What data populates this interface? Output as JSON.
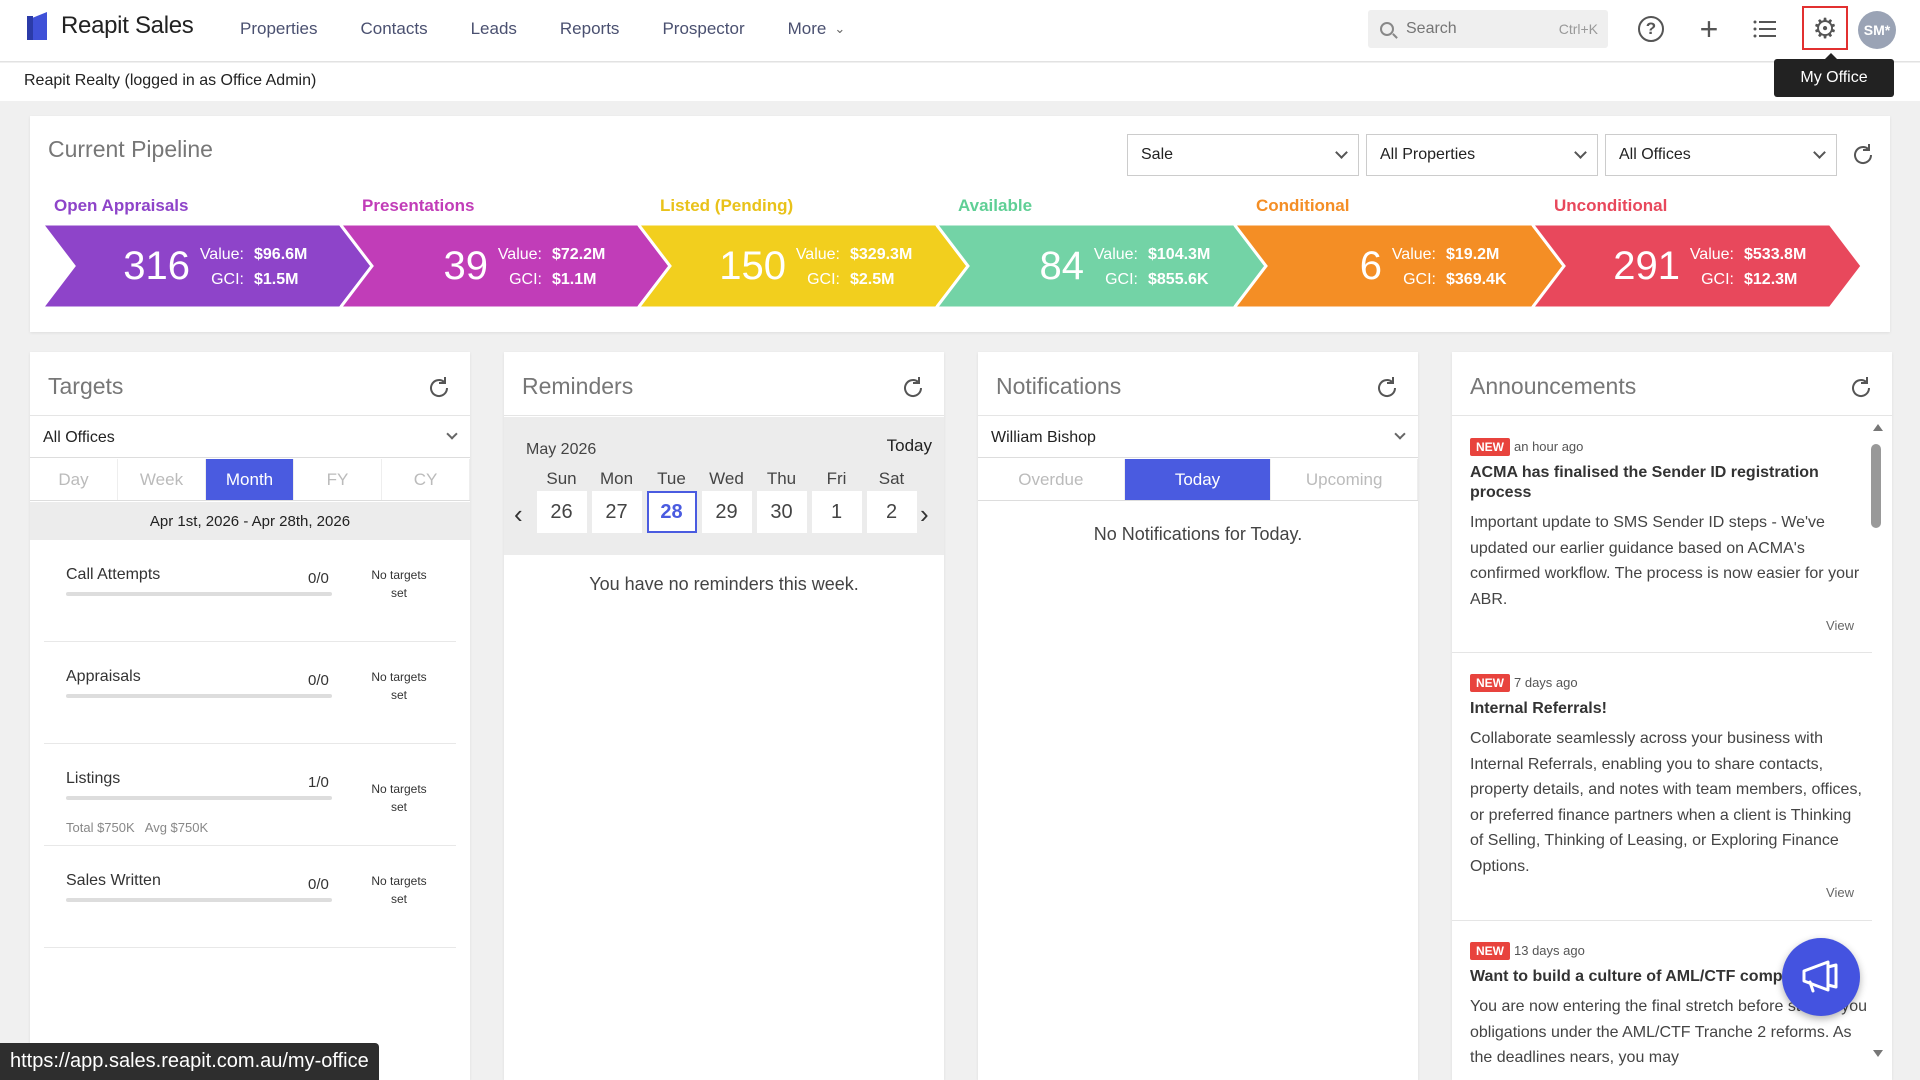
{
  "app": {
    "logo_text": "Reapit Sales",
    "context": "Reapit Realty (logged in as Office Admin)"
  },
  "nav": {
    "items": [
      "Properties",
      "Contacts",
      "Leads",
      "Reports",
      "Prospector",
      "More"
    ]
  },
  "search": {
    "placeholder": "Search",
    "shortcut": "Ctrl+K"
  },
  "toolbar": {
    "avatar_initials": "SM*",
    "tooltip": "My Office",
    "icons": [
      "help-icon",
      "plus-icon",
      "list-icon",
      "gear-icon"
    ]
  },
  "pipeline": {
    "title": "Current Pipeline",
    "filters": {
      "type": "Sale",
      "properties": "All Properties",
      "offices": "All Offices"
    },
    "value_label": "Value:",
    "gci_label": "GCI:",
    "stages": [
      {
        "label": "Open Appraisals",
        "count": "316",
        "value": "$96.6M",
        "gci": "$1.5M",
        "color": "#8e44c9"
      },
      {
        "label": "Presentations",
        "count": "39",
        "value": "$72.2M",
        "gci": "$1.1M",
        "color": "#c13db8"
      },
      {
        "label": "Listed (Pending)",
        "count": "150",
        "value": "$329.3M",
        "gci": "$2.5M",
        "color": "#f2cf1e"
      },
      {
        "label": "Available",
        "count": "84",
        "value": "$104.3M",
        "gci": "$855.6K",
        "color": "#73d3a6"
      },
      {
        "label": "Conditional",
        "count": "6",
        "value": "$19.2M",
        "gci": "$369.4K",
        "color": "#f48e25"
      },
      {
        "label": "Unconditional",
        "count": "291",
        "value": "$533.8M",
        "gci": "$12.3M",
        "color": "#e8485c"
      }
    ]
  },
  "targets": {
    "title": "Targets",
    "office_select": "All Offices",
    "tabs": [
      "Day",
      "Week",
      "Month",
      "FY",
      "CY"
    ],
    "active_tab": "Month",
    "date_range": "Apr 1st, 2026 - Apr 28th, 2026",
    "rows": [
      {
        "name": "Call Attempts",
        "ratio": "0/0",
        "note_line1": "No targets",
        "note_line2": "set",
        "sub": ""
      },
      {
        "name": "Appraisals",
        "ratio": "0/0",
        "note_line1": "No targets",
        "note_line2": "set",
        "sub": ""
      },
      {
        "name": "Listings",
        "ratio": "1/0",
        "note_line1": "No targets",
        "note_line2": "set",
        "sub": "Total $750K   Avg $750K"
      },
      {
        "name": "Sales Written",
        "ratio": "0/0",
        "note_line1": "No targets",
        "note_line2": "set",
        "sub": ""
      }
    ]
  },
  "reminders": {
    "title": "Reminders",
    "month": "May 2026",
    "today_label": "Today",
    "days": [
      "Sun",
      "Mon",
      "Tue",
      "Wed",
      "Thu",
      "Fri",
      "Sat"
    ],
    "dates": [
      "26",
      "27",
      "28",
      "29",
      "30",
      "1",
      "2"
    ],
    "selected_date": "28",
    "empty": "You have no reminders this week."
  },
  "notifications": {
    "title": "Notifications",
    "user_select": "William Bishop",
    "tabs": [
      "Overdue",
      "Today",
      "Upcoming"
    ],
    "active_tab": "Today",
    "empty": "No Notifications for Today."
  },
  "announcements": {
    "title": "Announcements",
    "badge": "NEW",
    "view_label": "View",
    "items": [
      {
        "ago": "an hour ago",
        "title": "ACMA has finalised the Sender ID registration process",
        "body": "Important update to SMS Sender ID steps - We've updated our earlier guidance based on ACMA's confirmed workflow. The process is now easier for your ABR."
      },
      {
        "ago": "7 days ago",
        "title": "Internal Referrals!",
        "body": "Collaborate seamlessly across your business with Internal Referrals, enabling you to share contacts, property details, and notes with team members, offices, or preferred finance partners when a client is Thinking of Selling, Thinking of Leasing, or Exploring Finance Options."
      },
      {
        "ago": "13 days ago",
        "title": "Want to build a culture of AML/CTF comp",
        "body": "You are now entering the final stretch before start of you obligations under the AML/CTF Tranche 2 reforms. As the deadlines nears, you may"
      }
    ]
  },
  "status_url": "https://app.sales.reapit.com.au/my-office"
}
